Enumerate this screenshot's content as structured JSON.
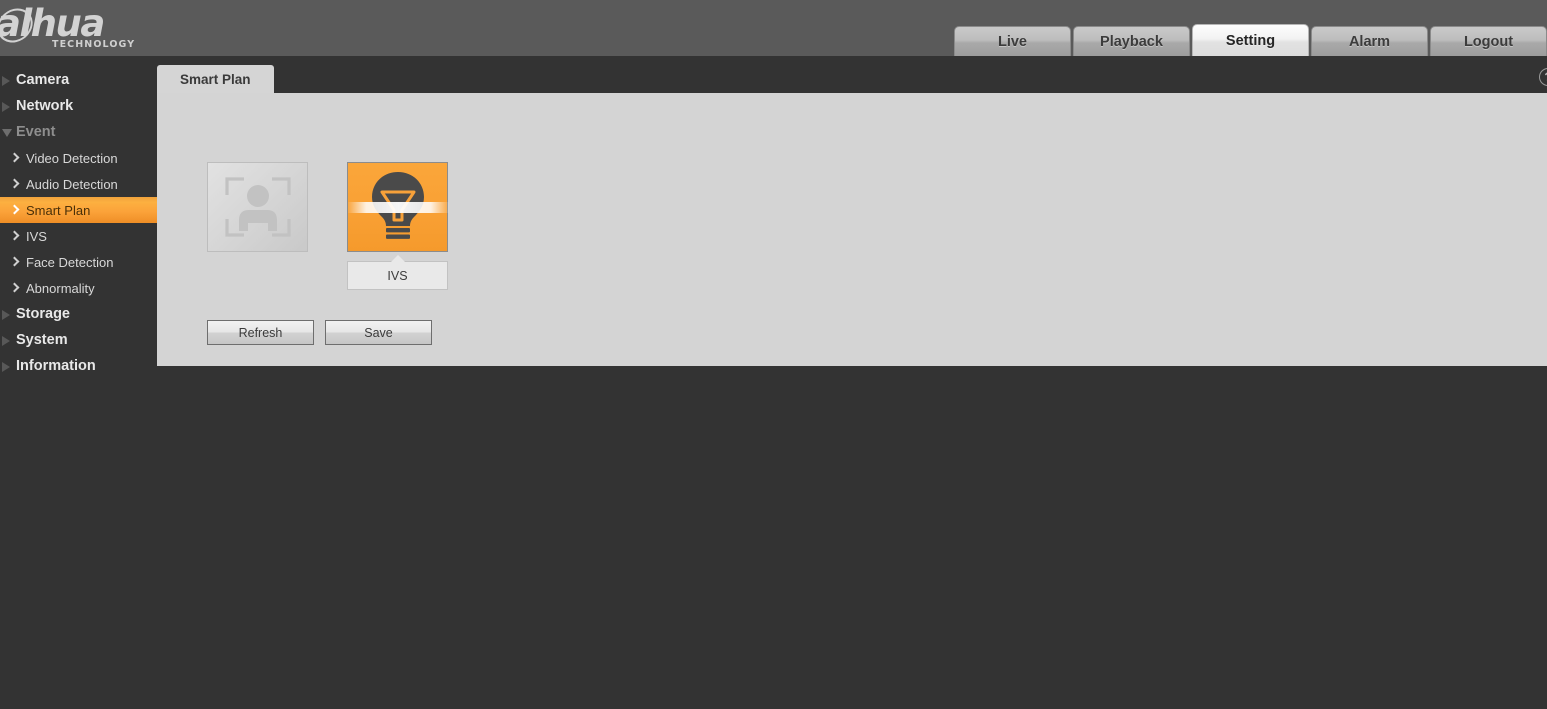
{
  "header": {
    "logo_main": "alhua",
    "logo_sub": "TECHNOLOGY",
    "logo_icon": "dahua-logo-icon"
  },
  "topnav": {
    "tabs": [
      {
        "label": "Live",
        "active": false
      },
      {
        "label": "Playback",
        "active": false
      },
      {
        "label": "Setting",
        "active": true
      },
      {
        "label": "Alarm",
        "active": false
      },
      {
        "label": "Logout",
        "active": false
      }
    ]
  },
  "sidebar": {
    "items": [
      {
        "label": "Camera",
        "type": "parent",
        "expanded": false
      },
      {
        "label": "Network",
        "type": "parent",
        "expanded": false
      },
      {
        "label": "Event",
        "type": "parent",
        "expanded": true
      },
      {
        "label": "Video Detection",
        "type": "child",
        "selected": false
      },
      {
        "label": "Audio Detection",
        "type": "child",
        "selected": false
      },
      {
        "label": "Smart Plan",
        "type": "child",
        "selected": true
      },
      {
        "label": "IVS",
        "type": "child",
        "selected": false
      },
      {
        "label": "Face Detection",
        "type": "child",
        "selected": false
      },
      {
        "label": "Abnormality",
        "type": "child",
        "selected": false
      },
      {
        "label": "Storage",
        "type": "parent",
        "expanded": false
      },
      {
        "label": "System",
        "type": "parent",
        "expanded": false
      },
      {
        "label": "Information",
        "type": "parent",
        "expanded": false
      }
    ]
  },
  "content": {
    "tab_label": "Smart Plan",
    "help_glyph": "?",
    "plans": [
      {
        "name": "Face Detection",
        "icon": "face-detection-icon",
        "selected": false,
        "label": ""
      },
      {
        "name": "IVS",
        "icon": "lightbulb-icon",
        "selected": true,
        "label": "IVS"
      }
    ],
    "buttons": {
      "refresh": "Refresh",
      "save": "Save"
    }
  },
  "colors": {
    "accent": "#fba33a",
    "header_bg": "#5a5a5a",
    "page_bg": "#333333",
    "panel_bg": "#d4d4d4"
  }
}
